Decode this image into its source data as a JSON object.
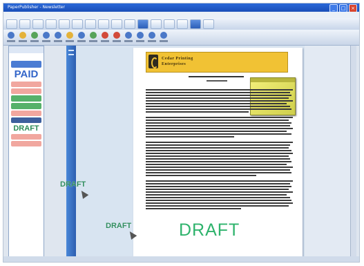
{
  "window": {
    "title": "PaperPublisher - Newsletter"
  },
  "sidebar": {
    "stickers": [
      "PAID",
      "DRAFT"
    ]
  },
  "document": {
    "logo_line1": "Cedar Printing",
    "logo_line2": "Enterprises",
    "big_stamp": "DRAFT"
  },
  "drag": {
    "stamp1": "DRAFT",
    "stamp2": "DRAFT"
  },
  "colors": {
    "accent": "#2a68d8",
    "stamp_green": "#2eb36c",
    "note_yellow": "#f3f07a"
  }
}
